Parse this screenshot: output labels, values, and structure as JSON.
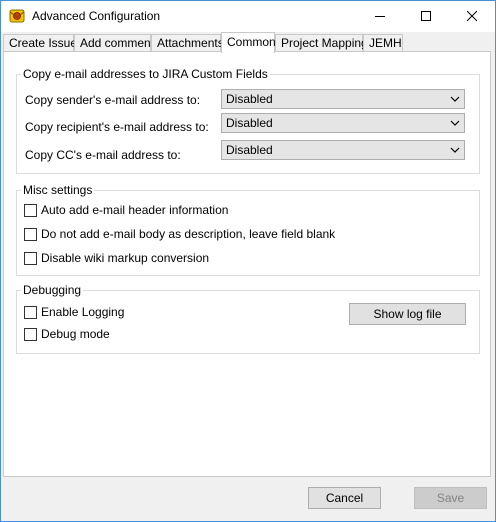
{
  "window": {
    "title": "Advanced Configuration",
    "app_icon": "jemh-app-icon",
    "controls": {
      "minimize": "minimize-icon",
      "maximize": "maximize-icon",
      "close": "close-icon"
    }
  },
  "tabs": [
    {
      "label": "Create Issue"
    },
    {
      "label": "Add comment"
    },
    {
      "label": "Attachments"
    },
    {
      "label": "Common",
      "active": true
    },
    {
      "label": "Project Mapping"
    },
    {
      "label": "JEMH"
    }
  ],
  "copy_email_group": {
    "title": "Copy e-mail addresses to JIRA Custom Fields",
    "fields": [
      {
        "label": "Copy sender's e-mail address to:",
        "value": "Disabled"
      },
      {
        "label": "Copy recipient's e-mail address to:",
        "value": "Disabled"
      },
      {
        "label": "Copy CC's e-mail address to:",
        "value": "Disabled"
      }
    ]
  },
  "misc_group": {
    "title": "Misc settings",
    "options": [
      {
        "label": "Auto add e-mail header information",
        "checked": false
      },
      {
        "label": "Do not add e-mail body as description, leave field blank",
        "checked": false
      },
      {
        "label": "Disable wiki markup conversion",
        "checked": false
      }
    ]
  },
  "debug_group": {
    "title": "Debugging",
    "options": [
      {
        "label": "Enable Logging",
        "checked": false
      },
      {
        "label": "Debug mode",
        "checked": false
      }
    ],
    "show_log_label": "Show log file"
  },
  "footer": {
    "cancel_label": "Cancel",
    "save_label": "Save",
    "save_enabled": false
  }
}
